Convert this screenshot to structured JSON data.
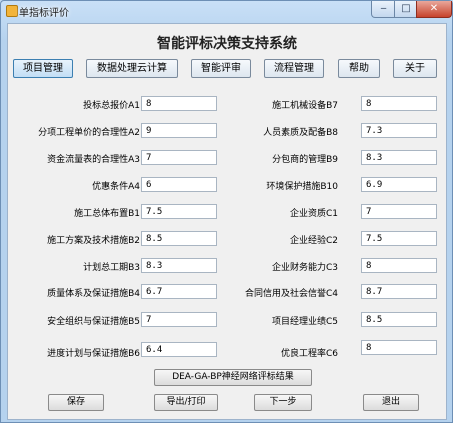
{
  "window": {
    "title": "单指标评价",
    "minimize": "‒",
    "maximize": "□",
    "close": "✕"
  },
  "heading": "智能评标决策支持系统",
  "menu": [
    "项目管理",
    "数据处理云计算",
    "智能评审",
    "流程管理",
    "帮助",
    "关于"
  ],
  "fields_left": [
    {
      "label": "投标总报价A1",
      "value": "8"
    },
    {
      "label": "分项工程单价的合理性A2",
      "value": "9"
    },
    {
      "label": "资金流量表的合理性A3",
      "value": "7"
    },
    {
      "label": "优惠条件A4",
      "value": "6"
    },
    {
      "label": "施工总体布置B1",
      "value": "7.5"
    },
    {
      "label": "施工方案及技术措施B2",
      "value": "8.5"
    },
    {
      "label": "计划总工期B3",
      "value": "8.3"
    },
    {
      "label": "质量体系及保证措施B4",
      "value": "6.7"
    },
    {
      "label": "安全组织与保证措施B5",
      "value": "7"
    },
    {
      "label": "进度计划与保证措施B6",
      "value": "6.4"
    }
  ],
  "fields_right": [
    {
      "label": "施工机械设备B7",
      "value": "8"
    },
    {
      "label": "人员素质及配备B8",
      "value": "7.3"
    },
    {
      "label": "分包商的管理B9",
      "value": "8.3"
    },
    {
      "label": "环境保护措施B10",
      "value": "6.9"
    },
    {
      "label": "企业资质C1",
      "value": "7"
    },
    {
      "label": "企业经验C2",
      "value": "7.5"
    },
    {
      "label": "企业财务能力C3",
      "value": "8"
    },
    {
      "label": "合同信用及社会信誉C4",
      "value": "8.7"
    },
    {
      "label": "项目经理业绩C5",
      "value": "8.5"
    },
    {
      "label": "优良工程率C6",
      "value": "8"
    }
  ],
  "result_button": "DEA-GA-BP神经网络评标结果",
  "buttons": {
    "save": "保存",
    "export": "导出/打印",
    "next": "下一步",
    "exit": "退出"
  }
}
